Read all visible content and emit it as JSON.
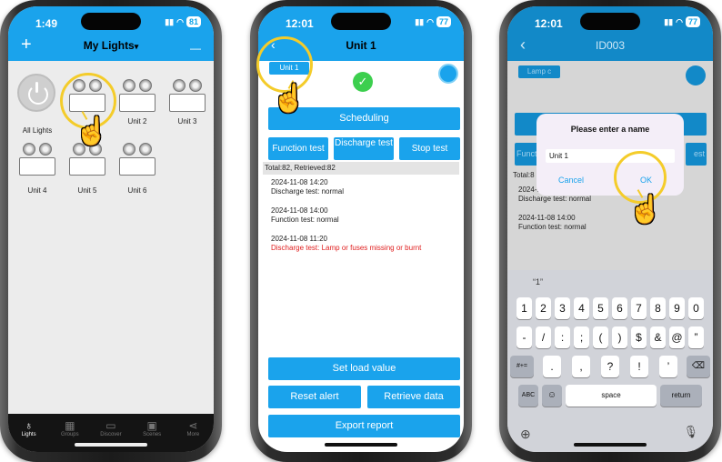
{
  "phone1": {
    "status_time": "1:49",
    "battery": "81",
    "nav_title": "My Lights",
    "nav_dropdown_glyph": "▾",
    "add_glyph": "+",
    "remove_glyph": "—",
    "lights": [
      {
        "label": "All Lights"
      },
      {
        "label": ""
      },
      {
        "label": "Unit 2"
      },
      {
        "label": "Unit 3"
      },
      {
        "label": "Unit 4"
      },
      {
        "label": "Unit 5"
      },
      {
        "label": "Unit 6"
      }
    ],
    "tabs": [
      {
        "label": "Lights",
        "icon": "lightbulb-icon",
        "active": true
      },
      {
        "label": "Groups",
        "icon": "groups-icon",
        "active": false
      },
      {
        "label": "Discover",
        "icon": "discover-icon",
        "active": false
      },
      {
        "label": "Scenes",
        "icon": "scenes-icon",
        "active": false
      },
      {
        "label": "More",
        "icon": "share-icon",
        "active": false
      }
    ]
  },
  "phone2": {
    "status_time": "12:01",
    "battery": "77",
    "nav_title": "Unit 1",
    "unit_tag": "Unit 1",
    "scheduling": "Scheduling",
    "function_test": "Function test",
    "discharge_test": "Discharge test",
    "stop_test": "Stop test",
    "totals": "Total:82, Retrieved:82",
    "logs": [
      {
        "time": "2024-11-08 14:20",
        "result": "Discharge test: normal",
        "error": false
      },
      {
        "time": "2024-11-08 14:00",
        "result": "Function test: normal",
        "error": false
      },
      {
        "time": "2024-11-08 11:20",
        "result": "Discharge test: Lamp or fuses missing or burnt",
        "error": true
      }
    ],
    "set_load": "Set load value",
    "reset_alert": "Reset alert",
    "retrieve_data": "Retrieve data",
    "export_report": "Export report"
  },
  "phone3": {
    "status_time": "12:01",
    "battery": "77",
    "nav_title": "ID003",
    "unit_tag": "Lamp c",
    "dialog_title": "Please enter a name",
    "input_value": "Unit 1",
    "cancel": "Cancel",
    "ok": "OK",
    "bg_func_frag": "Funct",
    "bg_stop_frag": "est",
    "bg_totals_frag": "Total:8",
    "bg_logs": [
      {
        "time": "2024-11-08 14:20",
        "result": "Discharge test: normal"
      },
      {
        "time": "2024-11-08 14:00",
        "result": "Function test: normal"
      }
    ],
    "suggestion": "“1”",
    "kb_row1": [
      "1",
      "2",
      "3",
      "4",
      "5",
      "6",
      "7",
      "8",
      "9",
      "0"
    ],
    "kb_row2": [
      "-",
      "/",
      ":",
      ";",
      "(",
      ")",
      "$",
      "&",
      "@",
      "”"
    ],
    "kb_row3_mid": [
      ".",
      ",",
      "?",
      "!",
      "’"
    ],
    "kb_symbols": "#+=",
    "kb_abc": "ABC",
    "kb_space": "space",
    "kb_return": "return"
  }
}
